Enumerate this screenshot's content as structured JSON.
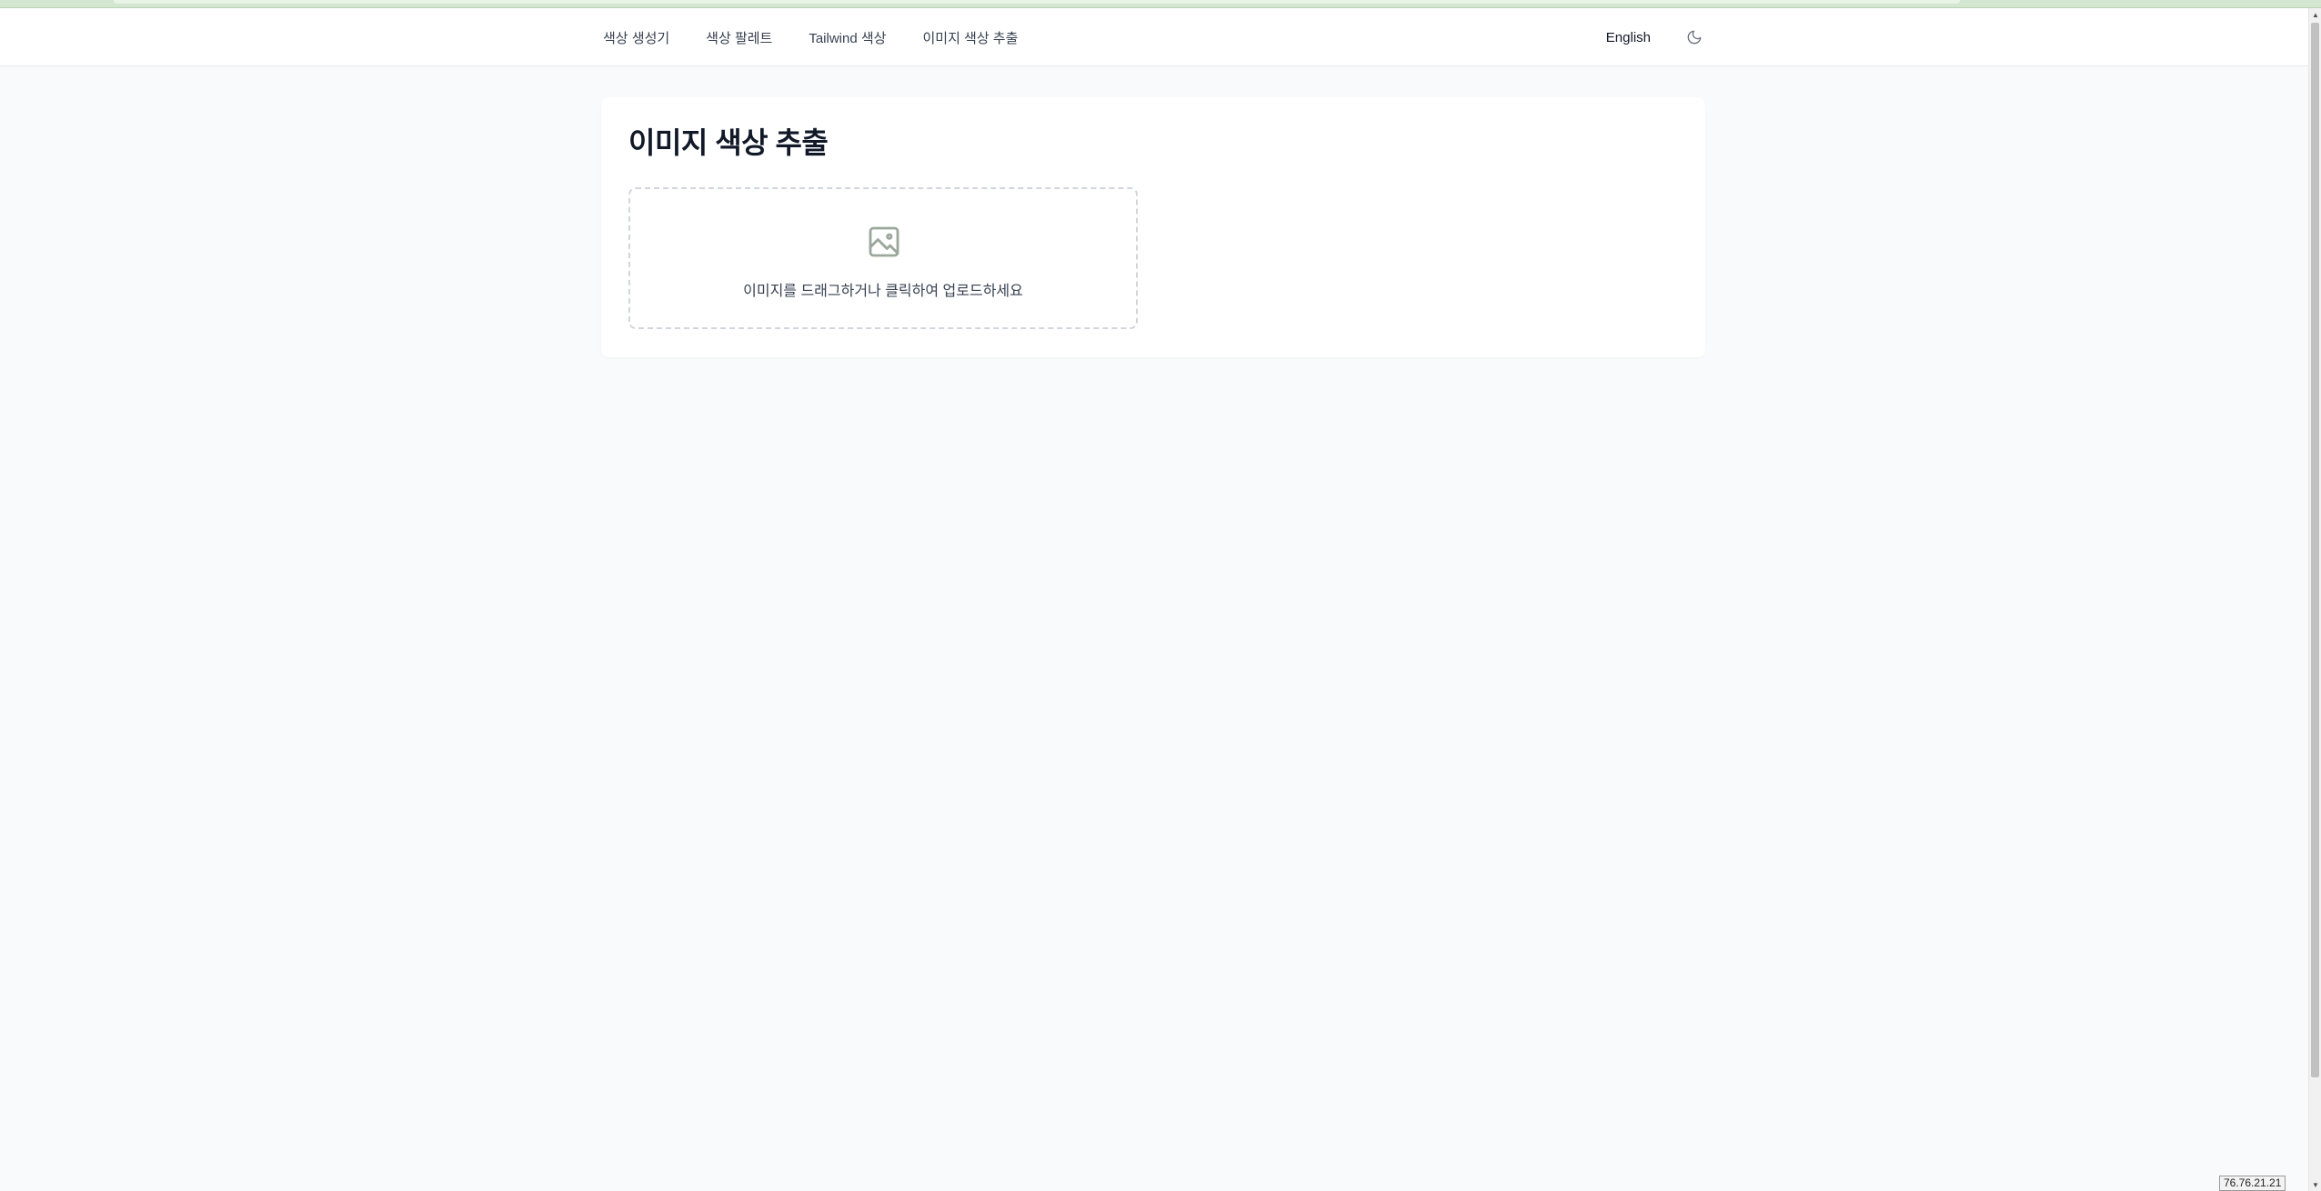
{
  "nav": {
    "links": [
      {
        "label": "색상 생성기"
      },
      {
        "label": "색상 팔레트"
      },
      {
        "label": "Tailwind 색상"
      },
      {
        "label": "이미지 색상 추출"
      }
    ],
    "language_label": "English",
    "theme_icon": "moon-icon"
  },
  "main": {
    "title": "이미지 색상 추출",
    "dropzone": {
      "icon": "image-icon",
      "hint": "이미지를 드래그하거나 클릭하여 업로드하세요"
    }
  },
  "status_tag": "76.76.21.21",
  "colors": {
    "page_background": "#f9fafb",
    "card_background": "#ffffff",
    "icon_color": "#9aa79a",
    "top_accent": "#d3e6cf"
  }
}
